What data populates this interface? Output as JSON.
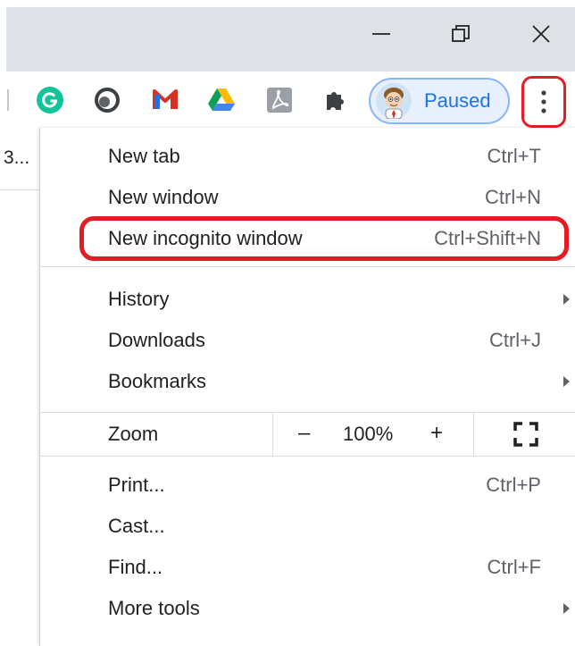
{
  "window": {
    "minimize_icon": "minimize-icon",
    "restore_icon": "restore-icon",
    "close_icon": "close-icon"
  },
  "toolbar": {
    "extensions": [
      "grammarly-icon",
      "circle-extension-icon",
      "gmail-checker-icon",
      "google-drive-icon",
      "pdf-icon",
      "puzzle-icon"
    ],
    "profile_label": "Paused",
    "menu_icon": "kebab-menu-icon"
  },
  "page": {
    "truncated_text": "3..."
  },
  "menu": {
    "items": [
      {
        "label": "New tab",
        "shortcut": "Ctrl+T"
      },
      {
        "label": "New window",
        "shortcut": "Ctrl+N"
      },
      {
        "label": "New incognito window",
        "shortcut": "Ctrl+Shift+N"
      },
      {
        "label": "History",
        "shortcut": ""
      },
      {
        "label": "Downloads",
        "shortcut": "Ctrl+J"
      },
      {
        "label": "Bookmarks",
        "shortcut": ""
      },
      {
        "label": "Print...",
        "shortcut": "Ctrl+P"
      },
      {
        "label": "Cast...",
        "shortcut": ""
      },
      {
        "label": "Find...",
        "shortcut": "Ctrl+F"
      },
      {
        "label": "More tools",
        "shortcut": ""
      }
    ],
    "zoom": {
      "label": "Zoom",
      "minus": "–",
      "value": "100%",
      "plus": "+"
    }
  },
  "colors": {
    "highlight": "#e51c23",
    "accent": "#1a73e8"
  }
}
